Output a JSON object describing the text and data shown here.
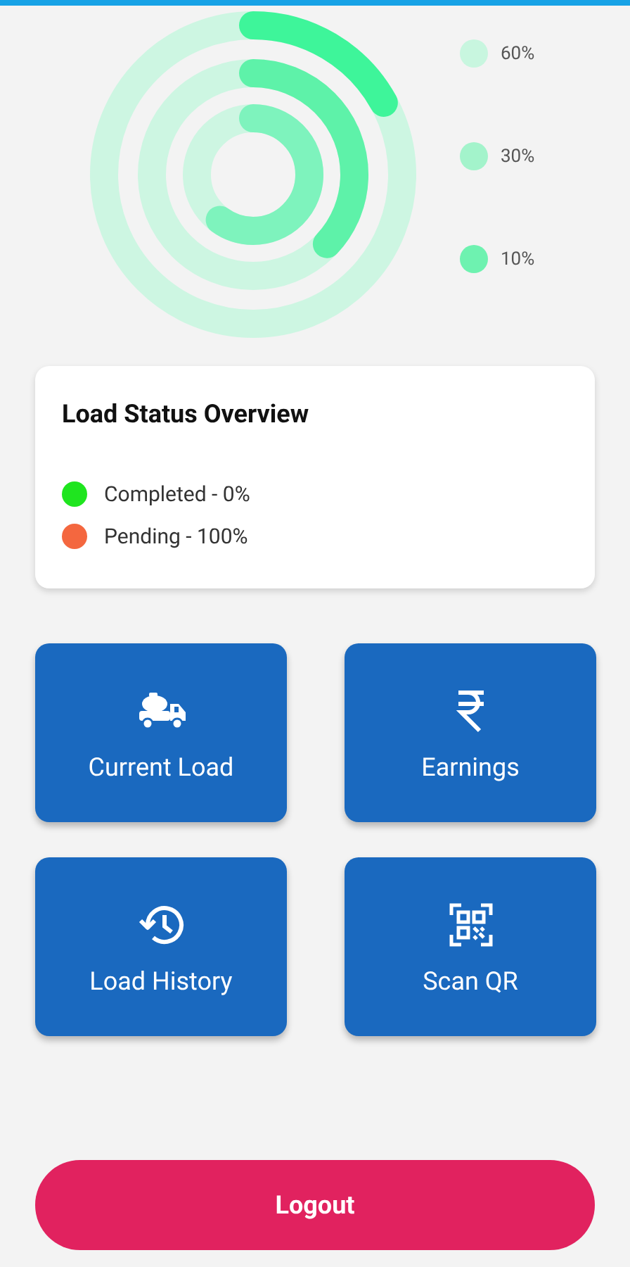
{
  "rings": [
    {
      "color": "#3ef59a"
    },
    {
      "color": "#5ef2a9"
    },
    {
      "color": "#7ef3bd"
    }
  ],
  "legend": [
    {
      "label": "60%",
      "color": "#c8f6df"
    },
    {
      "label": "30%",
      "color": "#a3f3cb"
    },
    {
      "label": "10%",
      "color": "#6ef2b0"
    }
  ],
  "status_card": {
    "title": "Load Status Overview",
    "items": [
      {
        "label": "Completed - 0%",
        "color": "#1fe51f"
      },
      {
        "label": "Pending - 100%",
        "color": "#f4673f"
      }
    ]
  },
  "tiles": [
    {
      "label": "Current Load",
      "kind": "truck"
    },
    {
      "label": "Earnings",
      "kind": "rupee"
    },
    {
      "label": "Load History",
      "kind": "history"
    },
    {
      "label": "Scan QR",
      "kind": "qr"
    }
  ],
  "logout": {
    "label": "Logout"
  }
}
